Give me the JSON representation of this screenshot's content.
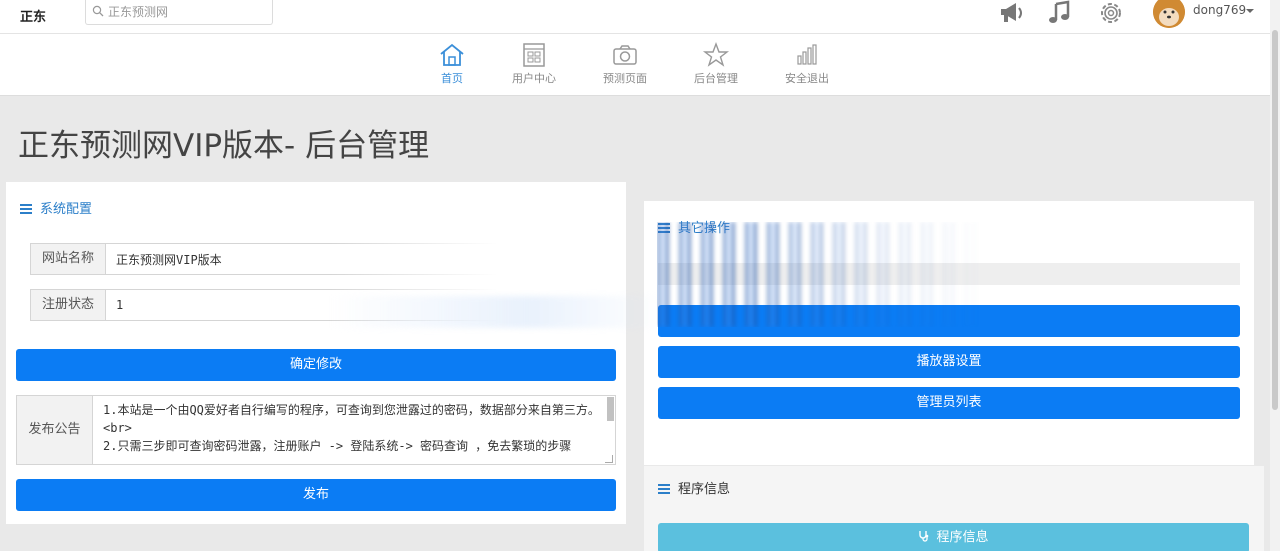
{
  "topbar": {
    "brand": "正东",
    "search_placeholder": "正东预测网",
    "icons": [
      "megaphone-icon",
      "music-icon",
      "gear-icon"
    ],
    "username": "dong769"
  },
  "nav": {
    "items": [
      {
        "label": "首页",
        "icon": "home-icon",
        "active": true
      },
      {
        "label": "用户中心",
        "icon": "user-center-icon",
        "active": false
      },
      {
        "label": "预测页面",
        "icon": "camera-icon",
        "active": false
      },
      {
        "label": "后台管理",
        "icon": "star-icon",
        "active": false
      },
      {
        "label": "安全退出",
        "icon": "bar-chart-icon",
        "active": false
      }
    ]
  },
  "page": {
    "title": "正东预测网VIP版本- 后台管理"
  },
  "config": {
    "heading": "系统配置",
    "site_name_label": "网站名称",
    "site_name_value": "正东预测网VIP版本",
    "register_label": "注册状态",
    "register_value": "1",
    "confirm_button": "确定修改",
    "notice_label": "发布公告",
    "notice_value": "1.本站是一个由QQ爱好者自行编写的程序，可查询到您泄露过的密码，数据部分来自第三方。<br>\n2.只需三步即可查询密码泄露，注册账户 -> 登陆系统-> 密码查询 ，免去繁琐的步骤",
    "publish_button": "发布"
  },
  "other": {
    "heading": "其它操作",
    "player_button": "播放器设置",
    "admin_button": "管理员列表"
  },
  "program": {
    "heading": "程序信息",
    "info_button": "程序信息"
  },
  "colors": {
    "primary": "#0b7cf4",
    "info": "#5bc0de",
    "accent": "#2c7fc9"
  }
}
